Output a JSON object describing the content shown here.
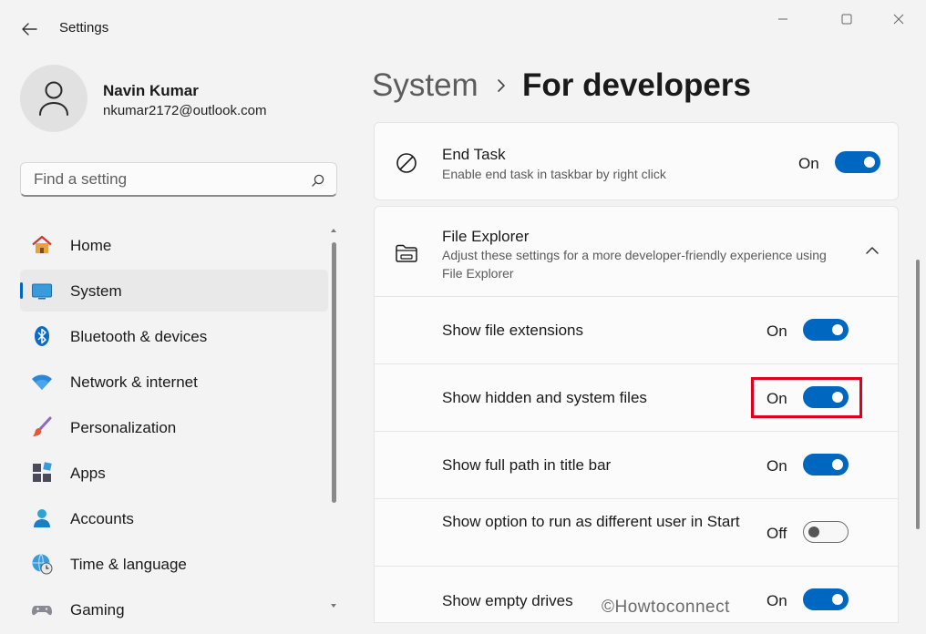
{
  "window": {
    "title": "Settings"
  },
  "user": {
    "name": "Navin Kumar",
    "email": "nkumar2172@outlook.com"
  },
  "search": {
    "placeholder": "Find a setting"
  },
  "nav": {
    "items": [
      {
        "label": "Home",
        "icon": "home-icon"
      },
      {
        "label": "System",
        "icon": "system-monitor-icon",
        "active": true
      },
      {
        "label": "Bluetooth & devices",
        "icon": "bluetooth-icon"
      },
      {
        "label": "Network & internet",
        "icon": "wifi-icon"
      },
      {
        "label": "Personalization",
        "icon": "paintbrush-icon"
      },
      {
        "label": "Apps",
        "icon": "apps-icon"
      },
      {
        "label": "Accounts",
        "icon": "account-icon"
      },
      {
        "label": "Time & language",
        "icon": "globe-clock-icon"
      },
      {
        "label": "Gaming",
        "icon": "gamepad-icon"
      }
    ]
  },
  "breadcrumb": {
    "parent": "System",
    "current": "For developers"
  },
  "settings": {
    "end_task": {
      "title": "End Task",
      "description": "Enable end task in taskbar by right click",
      "state": "On"
    },
    "file_explorer": {
      "title": "File Explorer",
      "description": "Adjust these settings for a more developer-friendly experience using File Explorer",
      "options": [
        {
          "label": "Show file extensions",
          "state": "On"
        },
        {
          "label": "Show hidden and system files",
          "state": "On"
        },
        {
          "label": "Show full path in title bar",
          "state": "On"
        },
        {
          "label": "Show option to run as different user in Start",
          "state": "Off"
        },
        {
          "label": "Show empty drives",
          "state": "On"
        }
      ]
    }
  },
  "watermark": "©Howtoconnect",
  "colors": {
    "accent": "#0067c0",
    "highlight": "#e0001b"
  }
}
